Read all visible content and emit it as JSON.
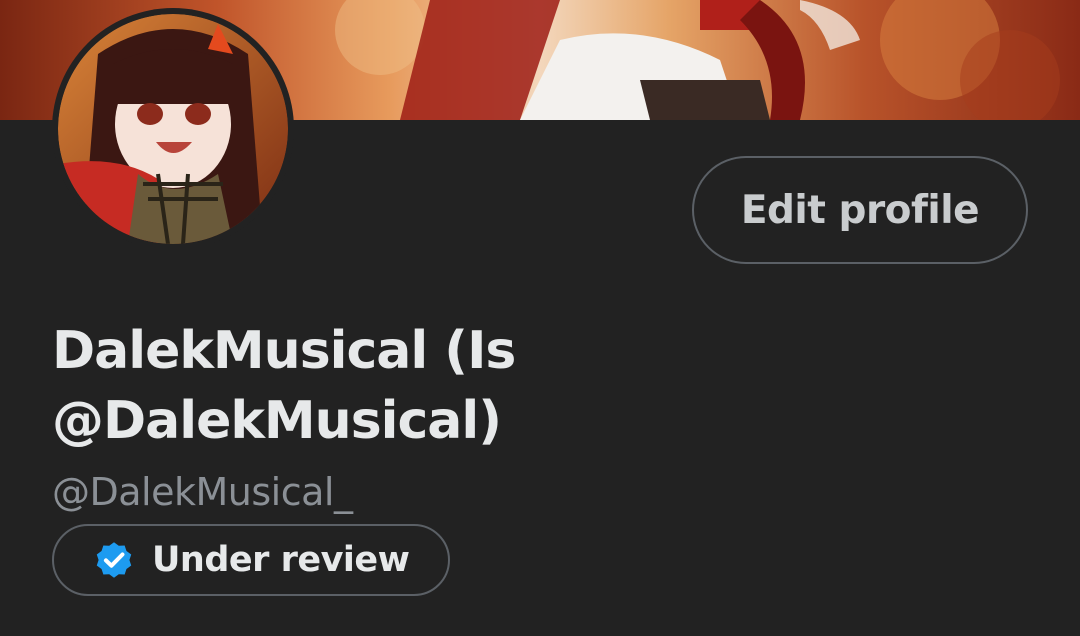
{
  "profile": {
    "display_name": "DalekMusical (Is @DalekMusical)",
    "handle": "@DalekMusical_",
    "edit_button_label": "Edit profile",
    "verification_status": "Under review",
    "verification_icon": "verified-badge-icon",
    "avatar_icon": "avatar-image",
    "banner_icon": "header-banner-image"
  },
  "colors": {
    "background": "#222222",
    "text_primary": "#e7e9ea",
    "text_secondary": "#8b9096",
    "button_border": "#5b6066",
    "verified_blue": "#1d9bf0"
  }
}
